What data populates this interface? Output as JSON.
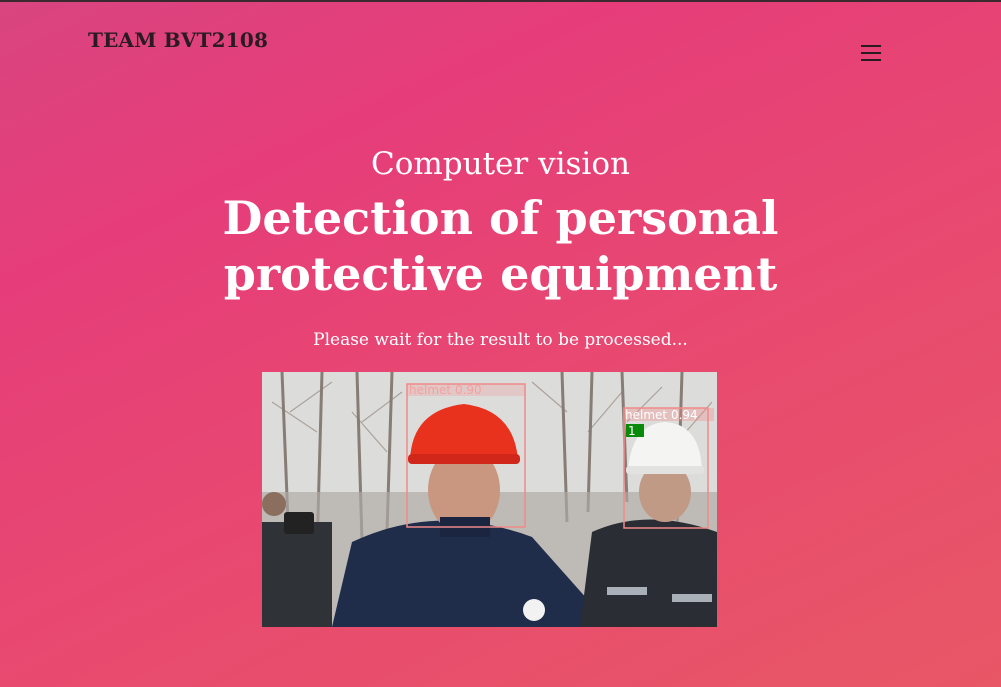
{
  "brand": {
    "name": "TEAM BVT2108"
  },
  "nav": {
    "menu_icon": "hamburger-menu-icon"
  },
  "hero": {
    "subtitle": "Computer vision",
    "title_line1": "Detection of personal",
    "title_line2": "protective equipment",
    "status": "Please wait for the result to be processed..."
  },
  "result": {
    "detections": [
      {
        "label": "helmet",
        "score": "0.90"
      },
      {
        "label": "helmet",
        "score": "0.94"
      }
    ],
    "id_tag": "1"
  },
  "colors": {
    "background_start": "#d9457f",
    "background_end": "#e85766",
    "box": "#f08a8a",
    "tag": "#0a8a0a"
  }
}
